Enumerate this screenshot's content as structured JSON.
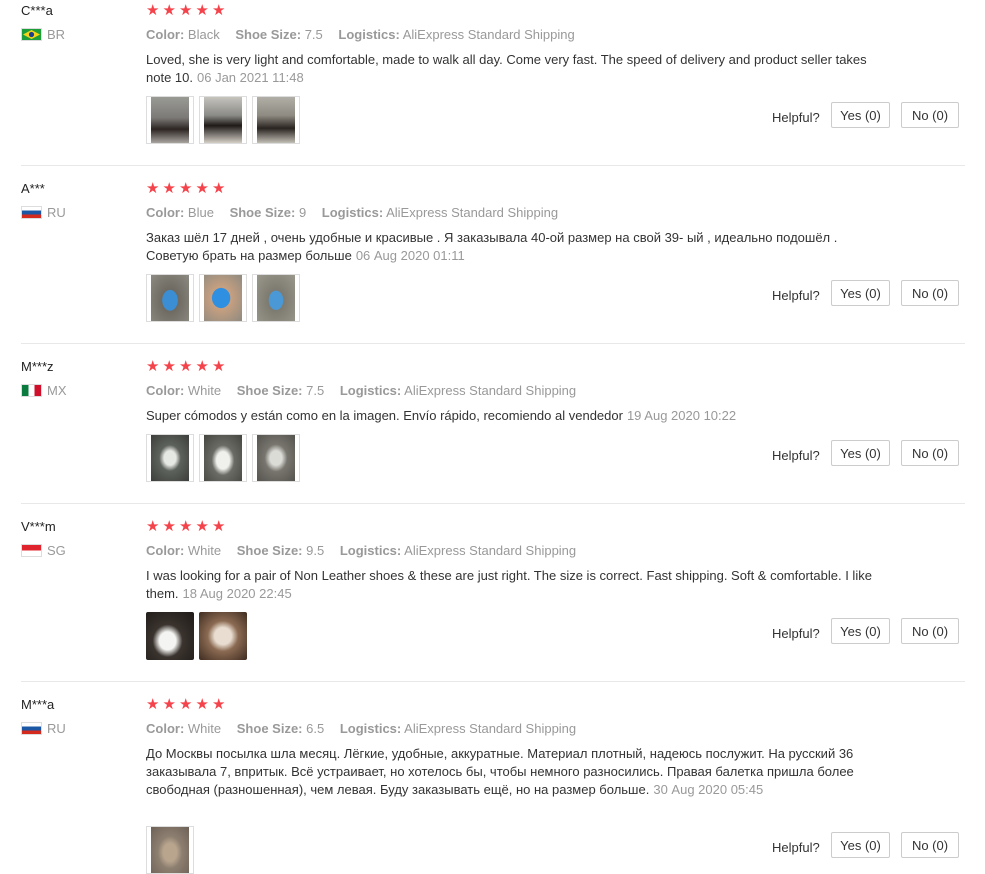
{
  "ui": {
    "helpful_label": "Helpful?",
    "color_key": "Color:",
    "size_key": "Shoe Size:",
    "logistics_key": "Logistics:"
  },
  "reviews": [
    {
      "user": "C***a",
      "country": "BR",
      "color": "Black",
      "size": "7.5",
      "logistics": "AliExpress Standard Shipping",
      "text": "Loved, she is very light and comfortable, made to walk all day. Come very fast. The speed of delivery and product seller takes note 10.",
      "date": "06 Jan 2021 11:48",
      "yes": "Yes (0)",
      "no": "No (0)",
      "photos": 3
    },
    {
      "user": "A***",
      "country": "RU",
      "color": "Blue",
      "size": "9",
      "logistics": "AliExpress Standard Shipping",
      "text": "Заказ шёл 17 дней , очень удобные и красивые . Я заказывала 40-ой размер на свой 39- ый , идеально подошёл . Советую брать на размер больше",
      "date": "06 Aug 2020 01:11",
      "yes": "Yes (0)",
      "no": "No (0)",
      "photos": 3
    },
    {
      "user": "M***z",
      "country": "MX",
      "color": "White",
      "size": "7.5",
      "logistics": "AliExpress Standard Shipping",
      "text": "Super cómodos y están como en la imagen. Envío rápido, recomiendo al vendedor",
      "date": "19 Aug 2020 10:22",
      "yes": "Yes (0)",
      "no": "No (0)",
      "photos": 3
    },
    {
      "user": "V***m",
      "country": "SG",
      "color": "White",
      "size": "9.5",
      "logistics": "AliExpress Standard Shipping",
      "text": "I was looking for a pair of Non Leather shoes & these are just right. The size is correct. Fast shipping. Soft & comfortable. I like them.",
      "date": "18 Aug 2020 22:45",
      "yes": "Yes (0)",
      "no": "No (0)",
      "photos": 2
    },
    {
      "user": "M***a",
      "country": "RU",
      "color": "White",
      "size": "6.5",
      "logistics": "AliExpress Standard Shipping",
      "text": "До Москвы посылка шла месяц. Лёгкие, удобные, аккуратные. Материал плотный, надеюсь послужит. На русский 36 заказывала 7, впритык. Всё устраивает, но хотелось бы, чтобы немного разносились. Правая балетка пришла более свободная (разношенная), чем левая. Буду заказывать ещё, но на размер больше.",
      "date": "30 Aug 2020 05:45",
      "yes": "Yes (0)",
      "no": "No (0)",
      "photos": 1
    }
  ],
  "rating_stars": 5,
  "colors": {
    "star": "#f5434b",
    "muted": "#999999",
    "border": "#cccccc"
  }
}
